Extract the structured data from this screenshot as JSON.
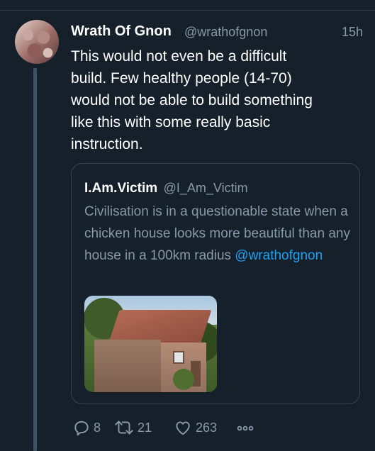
{
  "tweet": {
    "author_name": "Wrath Of Gnon",
    "author_handle": "@wrathofgnon",
    "time": "15h",
    "text": "This would not even be a difficult\nbuild. Few healthy people (14-70)\nwould not be able to build something\nlike this with some really basic\ninstruction."
  },
  "quote": {
    "author_name": "I.Am.Victim",
    "author_handle": "@I_Am_Victim",
    "text": "Civilisation is in a questionable state when a chicken house looks more beautiful than any house in a 100km radius",
    "mention": "@wrathofgnon"
  },
  "actions": {
    "reply_count": "8",
    "retweet_count": "21",
    "like_count": "263"
  },
  "colors": {
    "background": "#15202b",
    "secondary_text": "#8899a6",
    "link": "#1da1f2",
    "border": "#38444d"
  },
  "icons": [
    "reply-icon",
    "retweet-icon",
    "like-icon",
    "more-icon"
  ]
}
